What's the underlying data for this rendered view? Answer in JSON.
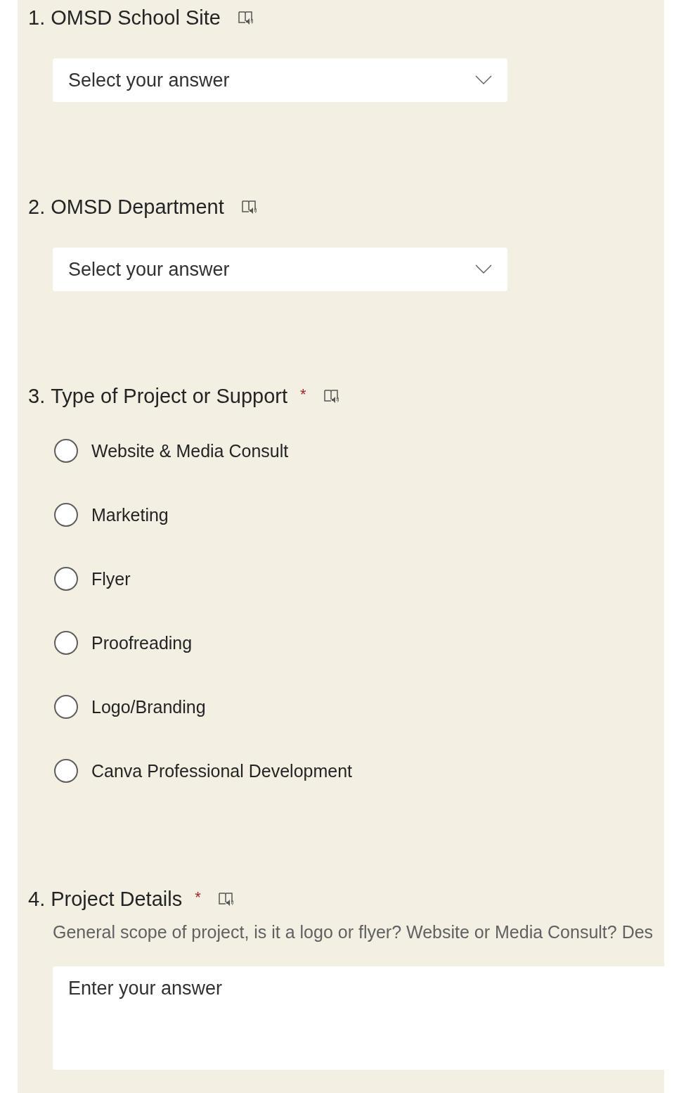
{
  "questions": [
    {
      "kind": "dropdown",
      "number": "1.",
      "title": "OMSD School Site",
      "required": false,
      "placeholder": "Select your answer"
    },
    {
      "kind": "dropdown",
      "number": "2.",
      "title": "OMSD Department",
      "required": false,
      "placeholder": "Select your answer"
    },
    {
      "kind": "choice",
      "number": "3.",
      "title": "Type of Project or Support",
      "required": true,
      "required_mark": "*",
      "options": [
        {
          "label": "Website & Media Consult",
          "selected": false
        },
        {
          "label": "Marketing",
          "selected": false
        },
        {
          "label": "Flyer",
          "selected": false
        },
        {
          "label": "Proofreading",
          "selected": false
        },
        {
          "label": "Logo/Branding",
          "selected": false
        },
        {
          "label": "Canva Professional Development",
          "selected": false
        }
      ]
    },
    {
      "kind": "text",
      "number": "4.",
      "title": "Project Details",
      "required": true,
      "required_mark": "*",
      "description": "General scope of project, is it a logo or flyer? Website or Media Consult? Des",
      "placeholder": "Enter your answer"
    }
  ]
}
